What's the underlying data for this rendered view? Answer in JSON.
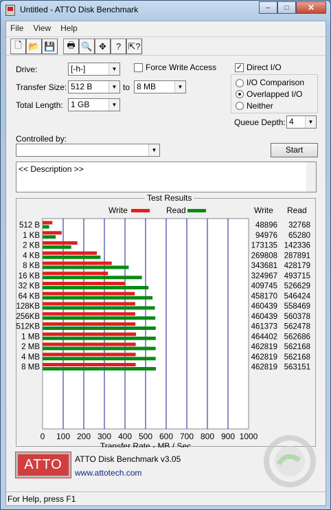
{
  "window": {
    "title": "Untitled - ATTO Disk Benchmark",
    "minimize_glyph": "–",
    "maximize_glyph": "□",
    "close_glyph": "✕"
  },
  "menu": [
    "File",
    "View",
    "Help"
  ],
  "toolbar": {
    "icons": [
      "new-icon",
      "open-icon",
      "save-icon",
      "print-icon",
      "print-preview-icon",
      "move-icon",
      "help-icon",
      "context-help-icon"
    ],
    "glyphs": [
      "🗋",
      "📂",
      "💾",
      "🖶",
      "🔍",
      "✥",
      "?",
      "⇱?"
    ]
  },
  "settings": {
    "drive_label": "Drive:",
    "drive_value": "[-h-]",
    "transfer_size_label": "Transfer Size:",
    "transfer_from": "512 B",
    "to_label": "to",
    "transfer_to": "8 MB",
    "total_length_label": "Total Length:",
    "total_length_value": "1 GB",
    "force_write_label": "Force Write Access",
    "force_write_checked": false,
    "direct_io_label": "Direct I/O",
    "direct_io_checked": true,
    "io_comparison_label": "I/O Comparison",
    "overlapped_io_label": "Overlapped I/O",
    "neither_label": "Neither",
    "selected_io_mode": "Overlapped I/O",
    "queue_depth_label": "Queue Depth:",
    "queue_depth_value": "4",
    "controlled_by_label": "Controlled by:",
    "controlled_by_value": "",
    "start_button": "Start",
    "description_text": "<< Description >>"
  },
  "results": {
    "title": "Test Results",
    "write_legend": "Write",
    "read_legend": "Read",
    "write_color": "#e02020",
    "read_color": "#0a8a14",
    "write_col_header": "Write",
    "read_col_header": "Read",
    "xlabel": "Transfer Rate - MB / Sec"
  },
  "chart_data": {
    "type": "bar",
    "orientation": "horizontal",
    "categories": [
      "512 B",
      "1 KB",
      "2 KB",
      "4 KB",
      "8 KB",
      "16 KB",
      "32 KB",
      "64 KB",
      "128KB",
      "256KB",
      "512KB",
      "1 MB",
      "2 MB",
      "4 MB",
      "8 MB"
    ],
    "series": [
      {
        "name": "Write",
        "values": [
          48896,
          94976,
          173135,
          269808,
          343681,
          324967,
          409745,
          458170,
          460439,
          460439,
          461373,
          464402,
          462819,
          462819,
          462819
        ]
      },
      {
        "name": "Read",
        "values": [
          32768,
          65280,
          142336,
          287891,
          428179,
          493715,
          526629,
          546424,
          558469,
          560378,
          562478,
          562686,
          562168,
          562168,
          563151
        ]
      }
    ],
    "xlabel": "Transfer Rate - MB / Sec",
    "xlim": [
      0,
      1000
    ],
    "xticks": [
      "0",
      "100",
      "200",
      "300",
      "400",
      "500",
      "600",
      "700",
      "800",
      "900",
      "1000"
    ],
    "grid": true,
    "legend_position": "top"
  },
  "footer": {
    "logo_text": "ATTO",
    "product_name": "ATTO Disk Benchmark v3.05",
    "url": "www.attotech.com"
  },
  "statusbar": {
    "text": "For Help, press F1"
  }
}
